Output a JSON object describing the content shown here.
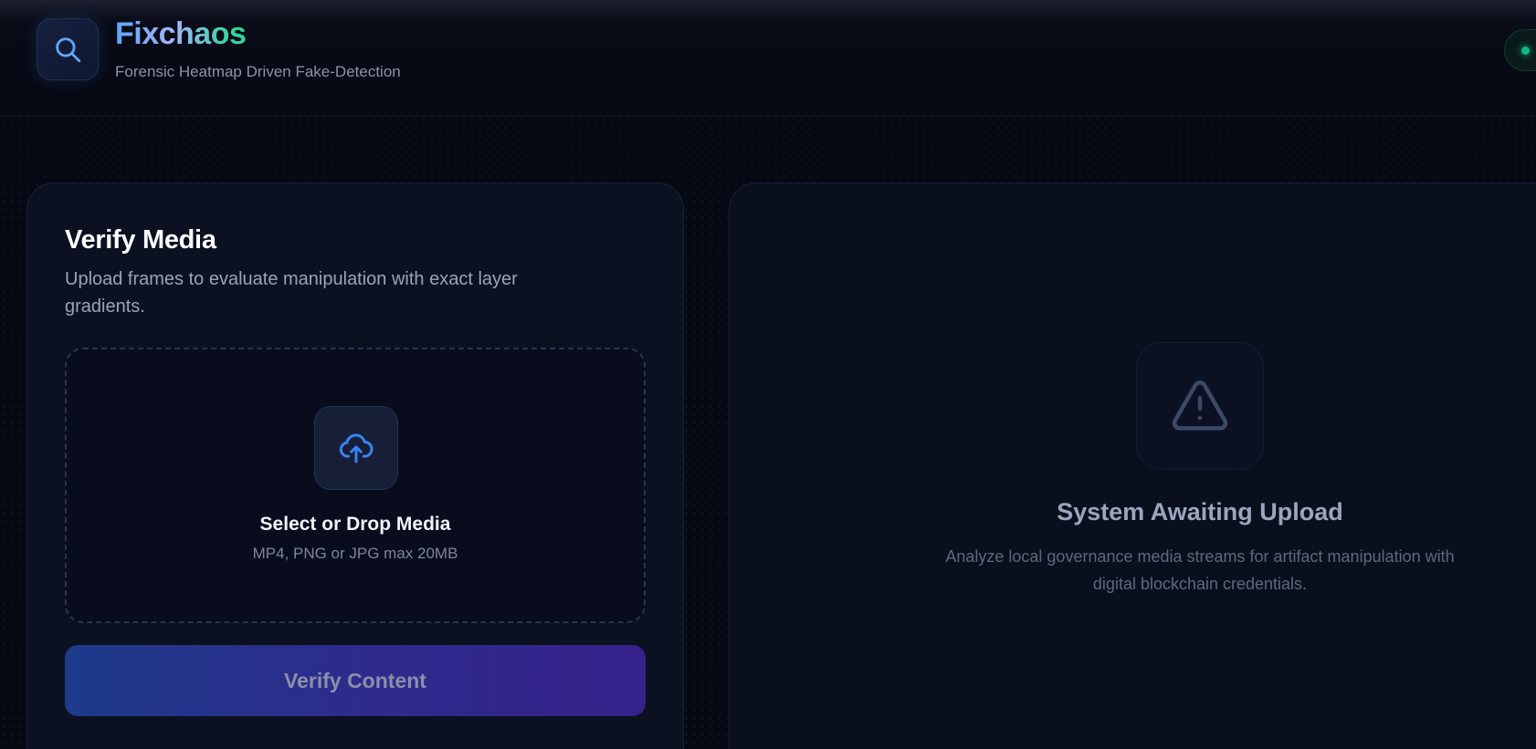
{
  "header": {
    "app_name": "Fixchaos",
    "subtitle": "Forensic Heatmap Driven Fake-Detection",
    "logo_icon": "search-icon",
    "status_indicator_color": "#10b981"
  },
  "upload_panel": {
    "title": "Verify Media",
    "description": "Upload frames to evaluate manipulation with exact layer gradients.",
    "dropzone": {
      "icon": "cloud-upload-icon",
      "title": "Select or Drop Media",
      "hint": "MP4, PNG or JPG max 20MB"
    },
    "submit_label": "Verify Content"
  },
  "result_panel": {
    "icon": "warning-triangle-icon",
    "title": "System Awaiting Upload",
    "description": "Analyze local governance media streams for artifact manipulation with digital blockchain credentials."
  },
  "colors": {
    "accent_blue": "#60a5fa",
    "accent_green": "#34d399",
    "button_gradient_start": "#1e3a8a",
    "button_gradient_end": "#35228a"
  }
}
